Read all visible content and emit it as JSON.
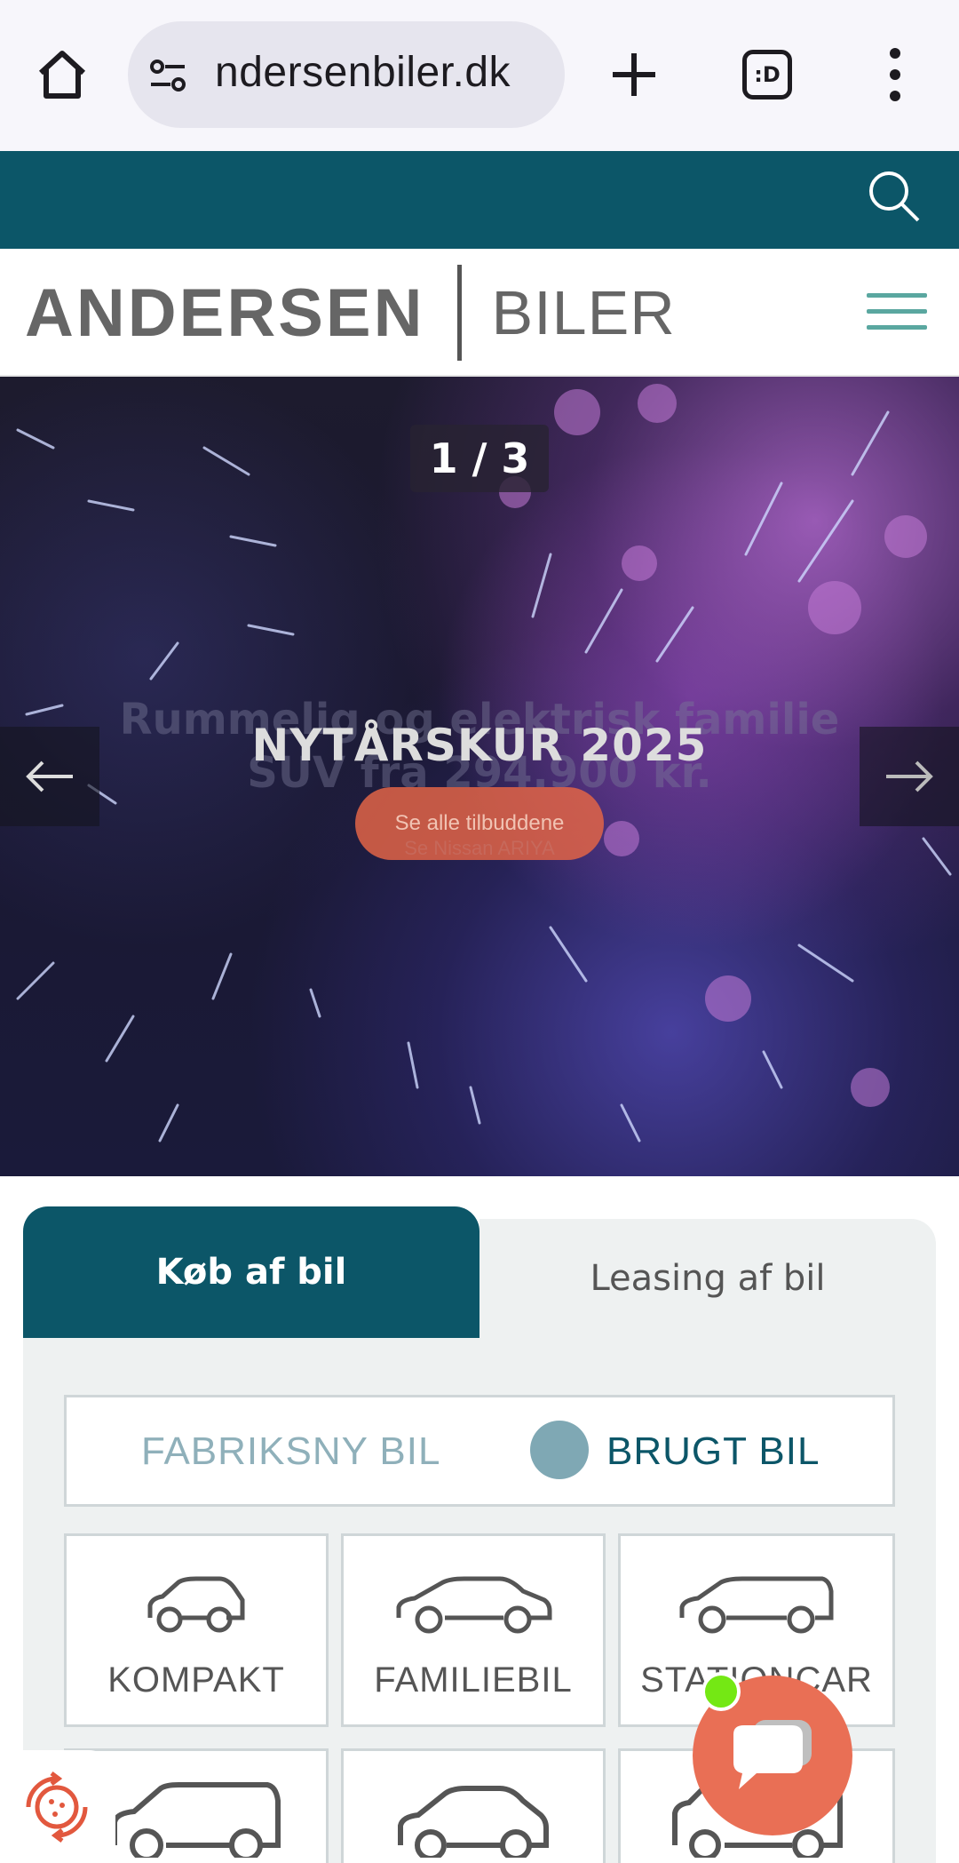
{
  "browser": {
    "url": "ndersenbiler.dk",
    "tab_switcher_label": ":D"
  },
  "header": {
    "logo_primary": "ANDERSEN",
    "logo_secondary": "BILER"
  },
  "hero": {
    "slide_counter": "1 / 3",
    "title": "NYTÅRSKUR 2025",
    "cta_label": "Se alle tilbuddene",
    "ghost_title": "Rummelig og elektrisk familie SUV fra 294.900 kr.",
    "ghost_cta": "Se Nissan ARIYA"
  },
  "search_tabs": [
    {
      "label": "Køb af bil",
      "active": true
    },
    {
      "label": "Leasing af bil",
      "active": false
    }
  ],
  "condition_toggle": {
    "option_new": "FABRIKSNY BIL",
    "option_used": "BRUGT BIL",
    "selected": "BRUGT BIL"
  },
  "categories": [
    {
      "label": "KOMPAKT",
      "icon": "compact-car-icon"
    },
    {
      "label": "FAMILIEBIL",
      "icon": "family-car-icon"
    },
    {
      "label": "STATIONCAR",
      "icon": "stationcar-icon"
    }
  ],
  "colors": {
    "brand_teal": "#0c5668",
    "accent_orange": "#e96f55",
    "online_green": "#74e814",
    "hamburger_teal": "#5aa7a0"
  }
}
